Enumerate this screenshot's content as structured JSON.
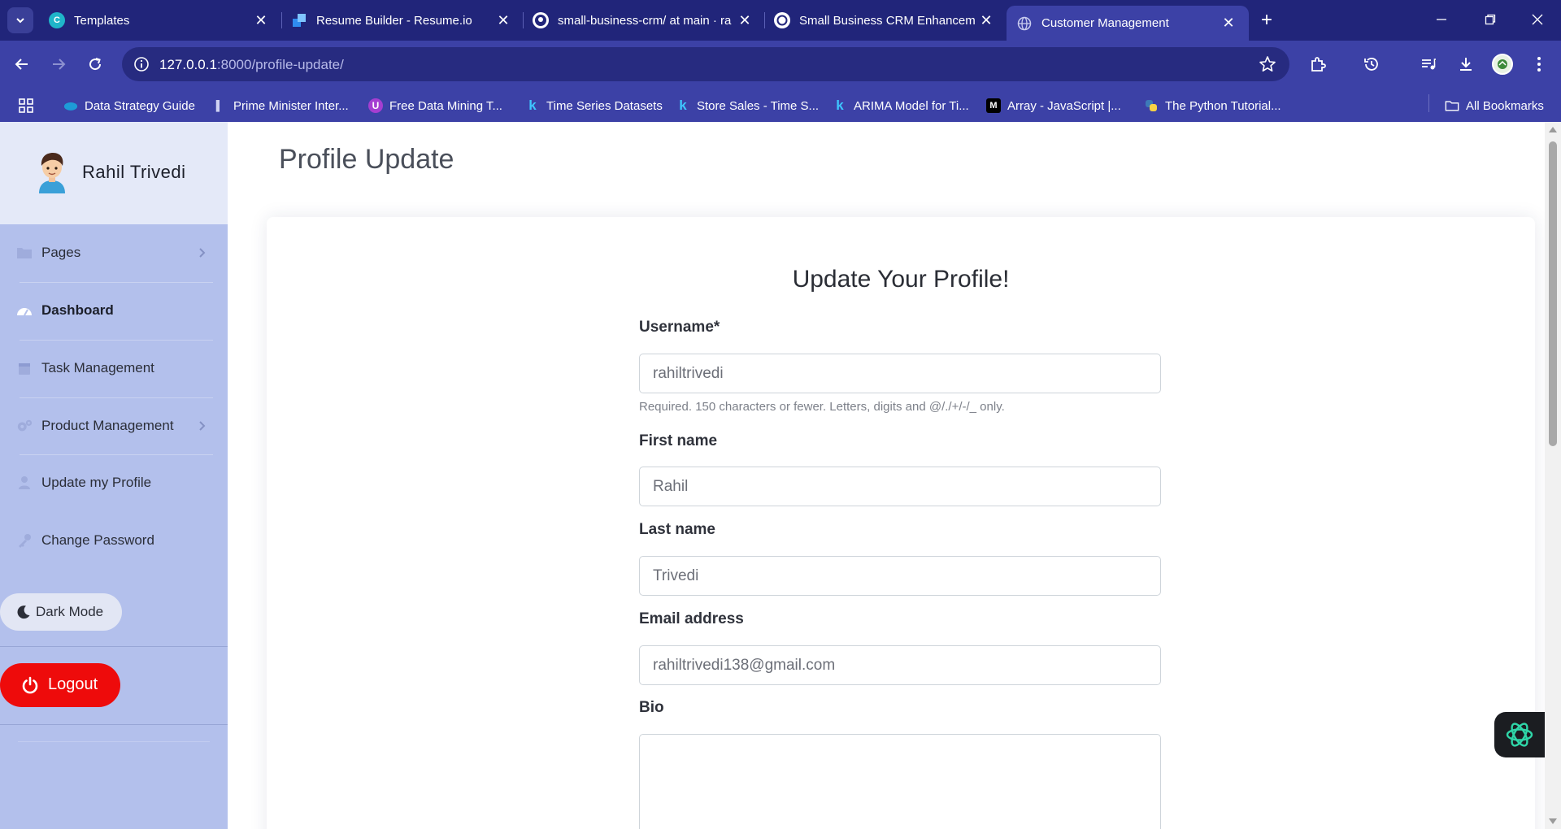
{
  "browser": {
    "tabs": [
      {
        "title": "Templates",
        "favicon": "canva-icon"
      },
      {
        "title": "Resume Builder - Resume.io",
        "favicon": "resumeio-icon"
      },
      {
        "title": "small-business-crm/ at main · ra",
        "favicon": "github-icon"
      },
      {
        "title": "Small Business CRM Enhanceme",
        "favicon": "openai-icon"
      },
      {
        "title": "Customer Management",
        "favicon": "globe-icon",
        "active": true
      }
    ],
    "url_host": "127.0.0.1",
    "url_path": ":8000/profile-update/",
    "bookmarks": [
      "Data Strategy Guide",
      "Prime Minister Inter...",
      "Free Data Mining T...",
      "Time Series Datasets",
      "Store Sales - Time S...",
      "ARIMA Model for Ti...",
      "Array - JavaScript |...",
      "The Python Tutorial..."
    ],
    "all_bookmarks": "All Bookmarks"
  },
  "sidebar": {
    "user_name": "Rahil Trivedi",
    "items": [
      {
        "label": "Pages",
        "icon": "folder-icon",
        "has_chevron": true
      },
      {
        "label": "Dashboard",
        "icon": "dashboard-gauge-icon",
        "active": true
      },
      {
        "label": "Task Management",
        "icon": "calendar-icon"
      },
      {
        "label": "Product Management",
        "icon": "gears-icon",
        "has_chevron": true
      },
      {
        "label": "Update my Profile",
        "icon": "user-icon"
      },
      {
        "label": "Change Password",
        "icon": "key-icon"
      }
    ],
    "dark_mode_label": "Dark Mode",
    "logout_label": "Logout"
  },
  "main": {
    "page_title": "Profile Update",
    "form_title": "Update Your Profile!",
    "fields": {
      "username": {
        "label": "Username*",
        "value": "rahiltrivedi",
        "help": "Required. 150 characters or fewer. Letters, digits and @/./+/-/_ only."
      },
      "first_name": {
        "label": "First name",
        "value": "Rahil"
      },
      "last_name": {
        "label": "Last name",
        "value": "Trivedi"
      },
      "email": {
        "label": "Email address",
        "value": "rahiltrivedi138@gmail.com"
      },
      "bio": {
        "label": "Bio",
        "value": ""
      }
    }
  },
  "colors": {
    "chrome_dark": "#21257a",
    "chrome": "#3c41a6",
    "sidebar": "#b3c0ec",
    "sidebar_head": "#e4e9f8",
    "logout": "#ee0b0b"
  }
}
